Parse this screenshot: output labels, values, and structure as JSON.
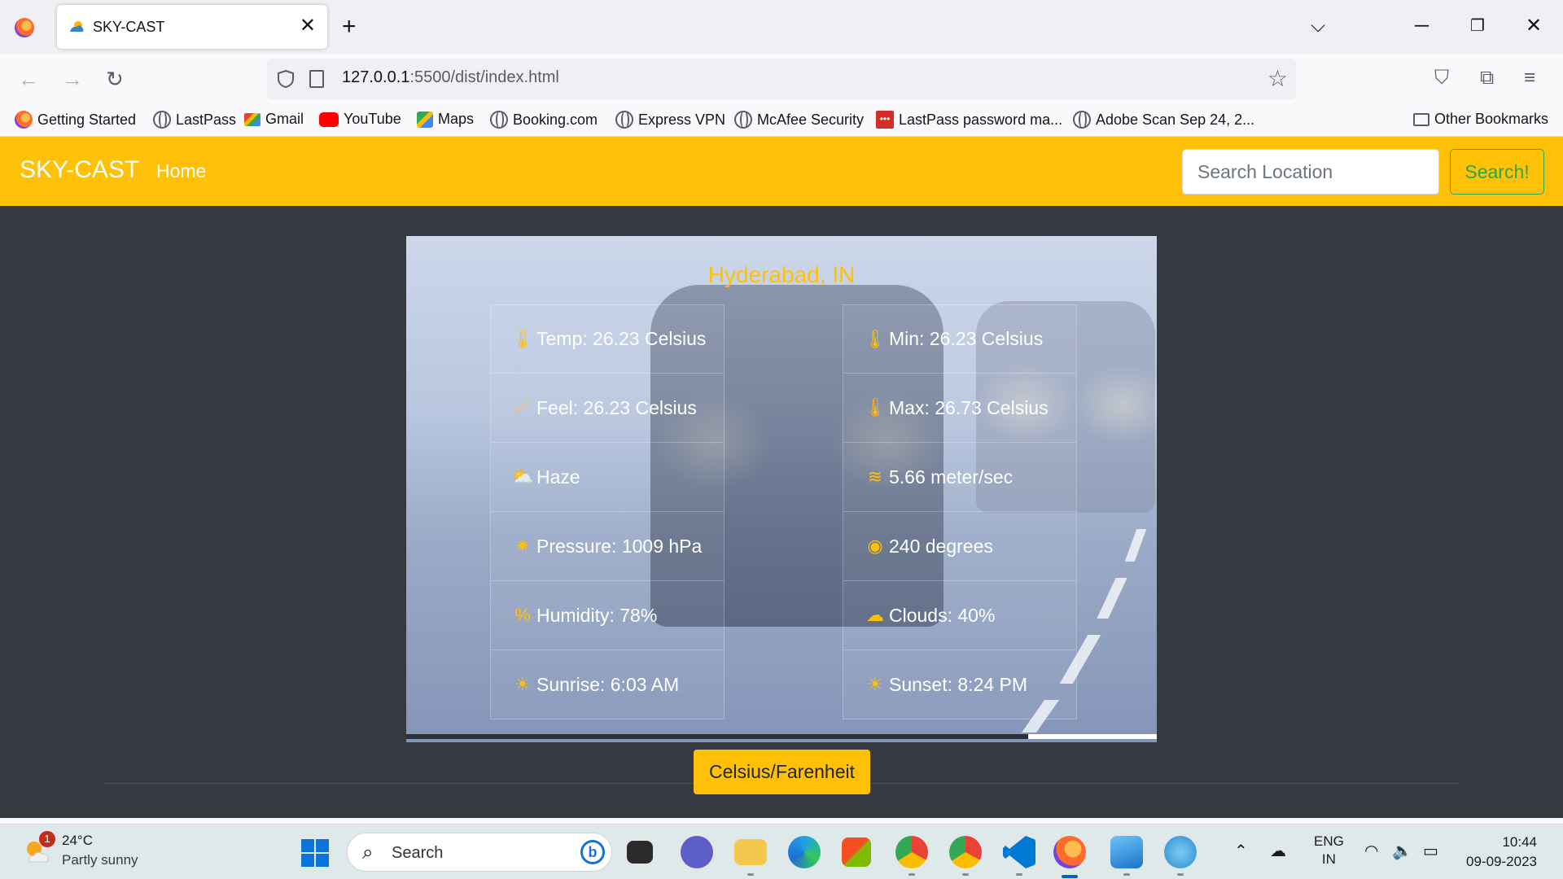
{
  "browser": {
    "tab_title": "SKY-CAST",
    "url_host": "127.0.0.1",
    "url_rest": ":5500/dist/index.html",
    "bookmarks": [
      {
        "label": "Getting Started",
        "icon": "firefox-icon"
      },
      {
        "label": "LastPass",
        "icon": "globe-icon"
      },
      {
        "label": "Gmail",
        "icon": "gmail-icon"
      },
      {
        "label": "YouTube",
        "icon": "youtube-icon"
      },
      {
        "label": "Maps",
        "icon": "maps-icon"
      },
      {
        "label": "Booking.com",
        "icon": "globe-icon"
      },
      {
        "label": "Express VPN",
        "icon": "globe-icon"
      },
      {
        "label": "McAfee Security",
        "icon": "globe-icon"
      },
      {
        "label": "LastPass password ma...",
        "icon": "lastpass-icon"
      },
      {
        "label": "Adobe Scan Sep 24, 2...",
        "icon": "globe-icon"
      }
    ],
    "other_bookmarks": "Other Bookmarks"
  },
  "site": {
    "brand": "SKY-CAST",
    "home": "Home",
    "search_placeholder": "Search Location",
    "search_button": "Search!",
    "accent_color": "#ffc107",
    "background_color": "#343a40"
  },
  "weather": {
    "city": "Hyderabad, IN",
    "left": [
      {
        "icon": "thermometer-icon",
        "text": "Temp: 26.23 Celsius"
      },
      {
        "icon": "feel-icon",
        "text": "Feel: 26.23 Celsius"
      },
      {
        "icon": "haze-icon",
        "text": "Haze"
      },
      {
        "icon": "pressure-icon",
        "text": "Pressure: 1009 hPa"
      },
      {
        "icon": "percent-icon",
        "text": "Humidity: 78%"
      },
      {
        "icon": "sun-icon",
        "text": "Sunrise: 6:03 AM"
      }
    ],
    "right": [
      {
        "icon": "temp-low-icon",
        "text": "Min: 26.23 Celsius"
      },
      {
        "icon": "temp-high-icon",
        "text": "Max: 26.73 Celsius"
      },
      {
        "icon": "wind-icon",
        "text": "5.66 meter/sec"
      },
      {
        "icon": "compass-icon",
        "text": "240 degrees"
      },
      {
        "icon": "cloud-icon",
        "text": "Clouds: 40%"
      },
      {
        "icon": "sun-icon",
        "text": "Sunset: 8:24 PM"
      }
    ],
    "toggle_button": "Celsius/Farenheit"
  },
  "taskbar": {
    "weather_temp": "24°C",
    "weather_desc": "Partly sunny",
    "weather_badge": "1",
    "search_text": "Search",
    "lang_line1": "ENG",
    "lang_line2": "IN",
    "time": "10:44",
    "date": "09-09-2023"
  }
}
